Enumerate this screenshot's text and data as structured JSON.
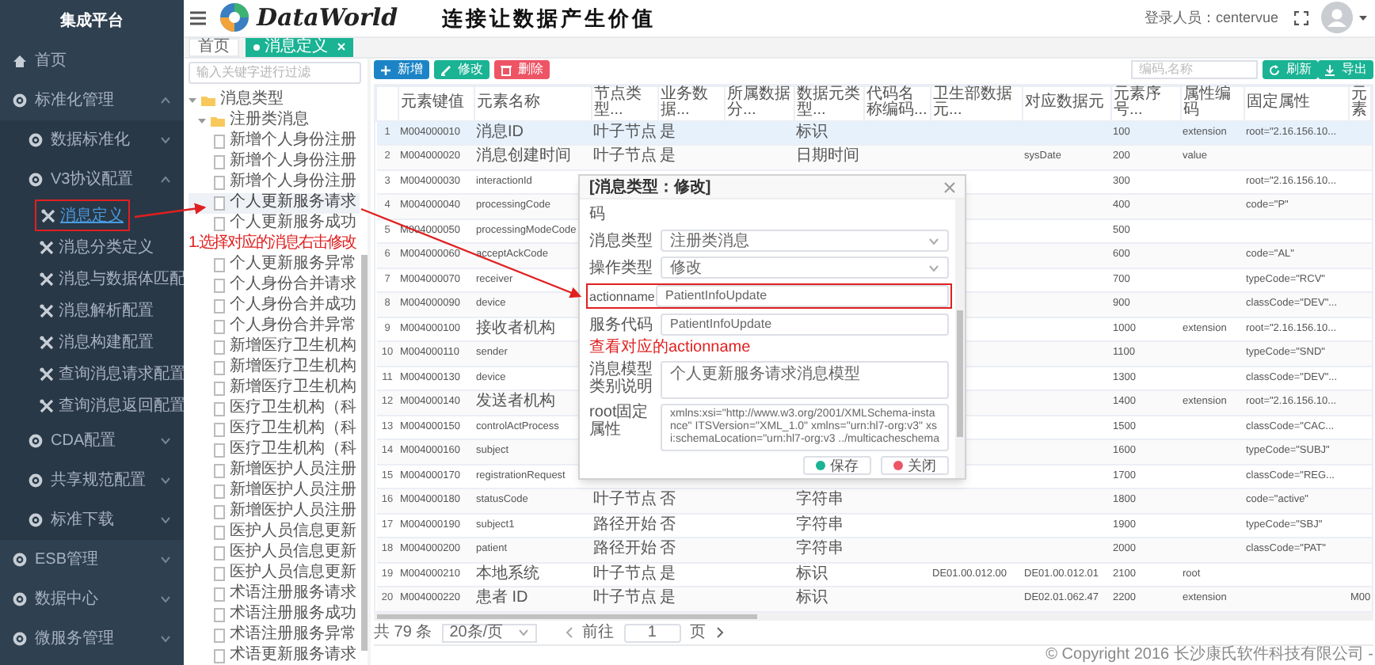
{
  "sidebar": {
    "title": "集成平台",
    "items": [
      {
        "label": "首页"
      },
      {
        "label": "标准化管理",
        "expanded": true,
        "children": [
          {
            "label": "数据标准化",
            "expanded": false
          },
          {
            "label": "V3协议配置",
            "expanded": true,
            "children": [
              {
                "label": "消息定义",
                "selected": true,
                "highlighted": true
              },
              {
                "label": "消息分类定义",
                "selected": false,
                "highlighted": false
              },
              {
                "label": "消息与数据体匹配",
                "selected": false,
                "highlighted": false
              },
              {
                "label": "消息解析配置",
                "selected": false,
                "highlighted": false
              },
              {
                "label": "消息构建配置",
                "selected": false,
                "highlighted": false
              },
              {
                "label": "查询消息请求配置",
                "selected": false,
                "highlighted": false
              },
              {
                "label": "查询消息返回配置",
                "selected": false,
                "highlighted": false
              }
            ]
          },
          {
            "label": "CDA配置",
            "expanded": false
          },
          {
            "label": "共享规范配置",
            "expanded": false
          },
          {
            "label": "标准下载",
            "expanded": false
          }
        ]
      },
      {
        "label": "ESB管理",
        "expanded": false
      },
      {
        "label": "数据中心",
        "expanded": false
      },
      {
        "label": "微服务管理",
        "expanded": false
      }
    ]
  },
  "header": {
    "logo": "DataWorld",
    "slogan": "连接让数据产生价值",
    "user_label": "登录人员：centervue"
  },
  "tabs": [
    {
      "label": "首页",
      "selected": false
    },
    {
      "label": "消息定义",
      "selected": true
    }
  ],
  "tree": {
    "placeholder": "输入关键字进行过滤",
    "nodes": [
      {
        "kind": "folder",
        "label": "消息类型",
        "expanded": true,
        "children": [
          {
            "kind": "folder",
            "label": "注册类消息",
            "expanded": true,
            "children": [
              {
                "kind": "leaf",
                "label": "新增个人身份注册",
                "selected": false
              },
              {
                "kind": "leaf",
                "label": "新增个人身份注册",
                "selected": false
              },
              {
                "kind": "leaf",
                "label": "新增个人身份注册",
                "selected": false
              },
              {
                "kind": "leaf",
                "label": "个人更新服务请求",
                "selected": true
              },
              {
                "kind": "leaf",
                "label": "个人更新服务成功",
                "selected": false
              },
              {
                "kind": "note",
                "label": "1.选择对应的消息右击修改"
              },
              {
                "kind": "leaf",
                "label": "个人更新服务异常",
                "selected": false
              },
              {
                "kind": "leaf",
                "label": "个人身份合并请求",
                "selected": false
              },
              {
                "kind": "leaf",
                "label": "个人身份合并成功",
                "selected": false
              },
              {
                "kind": "leaf",
                "label": "个人身份合并异常",
                "selected": false
              },
              {
                "kind": "leaf",
                "label": "新增医疗卫生机构",
                "selected": false
              },
              {
                "kind": "leaf",
                "label": "新增医疗卫生机构",
                "selected": false
              },
              {
                "kind": "leaf",
                "label": "新增医疗卫生机构",
                "selected": false
              },
              {
                "kind": "leaf",
                "label": "医疗卫生机构（科",
                "selected": false
              },
              {
                "kind": "leaf",
                "label": "医疗卫生机构（科",
                "selected": false
              },
              {
                "kind": "leaf",
                "label": "医疗卫生机构（科",
                "selected": false
              },
              {
                "kind": "leaf",
                "label": "新增医护人员注册",
                "selected": false
              },
              {
                "kind": "leaf",
                "label": "新增医护人员注册",
                "selected": false
              },
              {
                "kind": "leaf",
                "label": "新增医护人员注册",
                "selected": false
              },
              {
                "kind": "leaf",
                "label": "医护人员信息更新",
                "selected": false
              },
              {
                "kind": "leaf",
                "label": "医护人员信息更新",
                "selected": false
              },
              {
                "kind": "leaf",
                "label": "医护人员信息更新",
                "selected": false
              },
              {
                "kind": "leaf",
                "label": "术语注册服务请求",
                "selected": false
              },
              {
                "kind": "leaf",
                "label": "术语注册服务成功",
                "selected": false
              },
              {
                "kind": "leaf",
                "label": "术语注册服务异常",
                "selected": false
              },
              {
                "kind": "leaf",
                "label": "术语更新服务请求",
                "selected": false
              }
            ]
          }
        ]
      }
    ]
  },
  "toolbar": {
    "buttons": [
      {
        "label": "新增",
        "kind": "add"
      },
      {
        "label": "修改",
        "kind": "edit"
      },
      {
        "label": "删除",
        "kind": "delete"
      }
    ],
    "search_placeholder": "编码,名称",
    "right_buttons": [
      {
        "label": "刷新",
        "kind": "refresh"
      },
      {
        "label": "导出",
        "kind": "export"
      }
    ]
  },
  "table": {
    "columns": [
      "元素键值",
      "元素名称",
      "节点类型...",
      "业务数据...",
      "所属数据分...",
      "数据元类型...",
      "代码名称编码...",
      "卫生部数据元...",
      "对应数据元",
      "元素序号...",
      "属性编码",
      "固定属性",
      "元素"
    ],
    "rows": [
      {
        "no": "1",
        "selected": true,
        "key": "M004000010",
        "name": "消息ID",
        "node_type": "叶子节点",
        "business": "是",
        "data_type": "标识",
        "order": "100",
        "attr_code": "extension",
        "fixed_attr": "root=\"2.16.156.10..."
      },
      {
        "no": "2",
        "selected": false,
        "key": "M004000020",
        "name": "消息创建时间",
        "node_type": "叶子节点",
        "business": "是",
        "data_type": "日期时间",
        "mapped": "sysDate",
        "order": "200",
        "attr_code": "value"
      },
      {
        "no": "3",
        "selected": false,
        "key": "M004000030",
        "name": "interactionId",
        "order": "300",
        "fixed_attr": "root=\"2.16.156.10..."
      },
      {
        "no": "4",
        "selected": false,
        "key": "M004000040",
        "name": "processingCode",
        "order": "400",
        "fixed_attr": "code=\"P\""
      },
      {
        "no": "5",
        "selected": false,
        "key": "M004000050",
        "name": "processingModeCode",
        "order": "500"
      },
      {
        "no": "6",
        "selected": false,
        "key": "M004000060",
        "name": "acceptAckCode",
        "order": "600",
        "fixed_attr": "code=\"AL\""
      },
      {
        "no": "7",
        "selected": false,
        "key": "M004000070",
        "name": "receiver",
        "order": "700",
        "fixed_attr": "typeCode=\"RCV\""
      },
      {
        "no": "8",
        "selected": false,
        "key": "M004000090",
        "name": "device",
        "order": "900",
        "fixed_attr": "classCode=\"DEV\"..."
      },
      {
        "no": "9",
        "selected": false,
        "key": "M004000100",
        "name": "接收者机构",
        "order": "1000",
        "attr_code": "extension",
        "fixed_attr": "root=\"2.16.156.10..."
      },
      {
        "no": "10",
        "selected": false,
        "key": "M004000110",
        "name": "sender",
        "order": "1100",
        "fixed_attr": "typeCode=\"SND\""
      },
      {
        "no": "11",
        "selected": false,
        "key": "M004000130",
        "name": "device",
        "order": "1300",
        "fixed_attr": "classCode=\"DEV\"..."
      },
      {
        "no": "12",
        "selected": false,
        "key": "M004000140",
        "name": "发送者机构",
        "order": "1400",
        "attr_code": "extension",
        "fixed_attr": "root=\"2.16.156.10..."
      },
      {
        "no": "13",
        "selected": false,
        "key": "M004000150",
        "name": "controlActProcess",
        "order": "1500",
        "fixed_attr": "classCode=\"CAC..."
      },
      {
        "no": "14",
        "selected": false,
        "key": "M004000160",
        "name": "subject",
        "order": "1600",
        "fixed_attr": "typeCode=\"SUBJ\""
      },
      {
        "no": "15",
        "selected": false,
        "key": "M004000170",
        "name": "registrationRequest",
        "order": "1700",
        "fixed_attr": "classCode=\"REG..."
      },
      {
        "no": "16",
        "selected": false,
        "key": "M004000180",
        "name": "statusCode",
        "node_type": "叶子节点",
        "business": "否",
        "data_type": "字符串",
        "order": "1800",
        "fixed_attr": "code=\"active\""
      },
      {
        "no": "17",
        "selected": false,
        "key": "M004000190",
        "name": "subject1",
        "node_type": "路径开始",
        "business": "否",
        "data_type": "字符串",
        "order": "1900",
        "fixed_attr": "typeCode=\"SBJ\""
      },
      {
        "no": "18",
        "selected": false,
        "key": "M004000200",
        "name": "patient",
        "node_type": "路径开始",
        "business": "否",
        "data_type": "字符串",
        "order": "2000",
        "fixed_attr": "classCode=\"PAT\""
      },
      {
        "no": "19",
        "selected": false,
        "key": "M004000210",
        "name": "本地系统",
        "node_type": "叶子节点",
        "business": "是",
        "data_type": "标识",
        "moh": "DE01.00.012.00",
        "mapped": "DE01.00.012.01",
        "order": "2100",
        "attr_code": "root"
      },
      {
        "no": "20",
        "selected": false,
        "key": "M004000220",
        "name": "患者 ID",
        "node_type": "叶子节点",
        "business": "是",
        "data_type": "标识",
        "mapped": "DE02.01.062.47",
        "order": "2200",
        "attr_code": "extension",
        "column_13": "M00"
      }
    ]
  },
  "pagination": {
    "total": "共 79 条",
    "page_size": "20条/页",
    "goto": "前往",
    "page": "1",
    "page_unit": "页"
  },
  "footer": "© Copyright 2016 长沙康氏软件科技有限公司 -",
  "dialog": {
    "title": "[消息类型：修改]",
    "label_fragment": "码",
    "fields": [
      {
        "kind": "select",
        "label": "消息类型",
        "value": "注册类消息",
        "highlighted": false
      },
      {
        "kind": "select",
        "label": "操作类型",
        "value": "修改",
        "highlighted": false
      },
      {
        "kind": "text",
        "label": "actionname",
        "value": "PatientInfoUpdate",
        "highlighted": true
      },
      {
        "kind": "text",
        "label": "服务代码",
        "value": "PatientInfoUpdate",
        "highlighted": false
      },
      {
        "kind": "note",
        "label": "查看对应的actionname"
      },
      {
        "kind": "textarea",
        "label": "消息模型类别说明",
        "value": "个人更新服务请求消息模型",
        "highlighted": false
      },
      {
        "kind": "textarea",
        "label": "root固定属性",
        "value": "xmlns:xsi=\"http://www.w3.org/2001/XMLSchema-instance\" ITSVersion=\"XML_1.0\" xmlns=\"urn:hl7-org:v3\" xsi:schemaLocation=\"urn:hl7-org:v3 ../multicacheschema",
        "highlighted": false
      }
    ],
    "buttons": [
      {
        "label": "保存",
        "kind": "save"
      },
      {
        "label": "关闭",
        "kind": "close"
      }
    ]
  }
}
